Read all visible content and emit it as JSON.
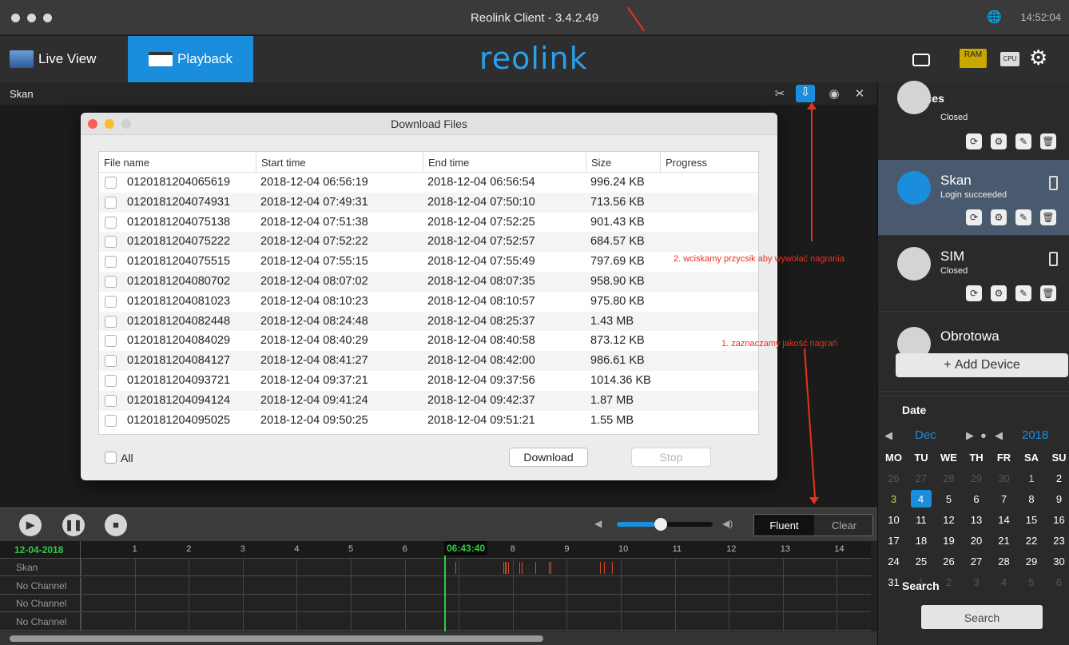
{
  "window": {
    "title": "Reolink Client - 3.4.2.49",
    "clock": "14:52:04"
  },
  "nav": {
    "live_view": "Live View",
    "playback": "Playback",
    "logo": "reolink",
    "ram": "RAM",
    "cpu": "CPU"
  },
  "subbar": {
    "title": "Skan"
  },
  "dialog": {
    "title": "Download Files",
    "columns": [
      "File name",
      "Start time",
      "End time",
      "Size",
      "Progress"
    ],
    "rows": [
      {
        "name": "0120181204065619",
        "start": "2018-12-04 06:56:19",
        "end": "2018-12-04 06:56:54",
        "size": "996.24 KB"
      },
      {
        "name": "0120181204074931",
        "start": "2018-12-04 07:49:31",
        "end": "2018-12-04 07:50:10",
        "size": "713.56 KB"
      },
      {
        "name": "0120181204075138",
        "start": "2018-12-04 07:51:38",
        "end": "2018-12-04 07:52:25",
        "size": "901.43 KB"
      },
      {
        "name": "0120181204075222",
        "start": "2018-12-04 07:52:22",
        "end": "2018-12-04 07:52:57",
        "size": "684.57 KB"
      },
      {
        "name": "0120181204075515",
        "start": "2018-12-04 07:55:15",
        "end": "2018-12-04 07:55:49",
        "size": "797.69 KB"
      },
      {
        "name": "0120181204080702",
        "start": "2018-12-04 08:07:02",
        "end": "2018-12-04 08:07:35",
        "size": "958.90 KB"
      },
      {
        "name": "0120181204081023",
        "start": "2018-12-04 08:10:23",
        "end": "2018-12-04 08:10:57",
        "size": "975.80 KB"
      },
      {
        "name": "0120181204082448",
        "start": "2018-12-04 08:24:48",
        "end": "2018-12-04 08:25:37",
        "size": "1.43 MB"
      },
      {
        "name": "0120181204084029",
        "start": "2018-12-04 08:40:29",
        "end": "2018-12-04 08:40:58",
        "size": "873.12 KB"
      },
      {
        "name": "0120181204084127",
        "start": "2018-12-04 08:41:27",
        "end": "2018-12-04 08:42:00",
        "size": "986.61 KB"
      },
      {
        "name": "0120181204093721",
        "start": "2018-12-04 09:37:21",
        "end": "2018-12-04 09:37:56",
        "size": "1014.36 KB"
      },
      {
        "name": "0120181204094124",
        "start": "2018-12-04 09:41:24",
        "end": "2018-12-04 09:42:37",
        "size": "1.87 MB"
      },
      {
        "name": "0120181204095025",
        "start": "2018-12-04 09:50:25",
        "end": "2018-12-04 09:51:21",
        "size": "1.55 MB"
      }
    ],
    "all_label": "All",
    "download_label": "Download",
    "stop_label": "Stop"
  },
  "controls": {
    "fluent": "Fluent",
    "clear": "Clear",
    "volume_level": 0.4
  },
  "timeline": {
    "date": "12-04-2018",
    "current_time": "06:43:40",
    "hours": [
      "1",
      "2",
      "3",
      "4",
      "5",
      "6",
      "7",
      "8",
      "9",
      "10",
      "11",
      "12",
      "13",
      "14"
    ],
    "channels": [
      "Skan",
      "No Channel",
      "No Channel",
      "No Channel"
    ]
  },
  "devices": {
    "header": "Devices",
    "list": [
      {
        "name": "",
        "status": "Closed"
      },
      {
        "name": "Skan",
        "status": "Login succeeded"
      },
      {
        "name": "SIM",
        "status": "Closed"
      },
      {
        "name": "Obrotowa",
        "status": ""
      }
    ],
    "add_label": "Add Device"
  },
  "calendar": {
    "header": "Date",
    "month": "Dec",
    "year": "2018",
    "weekdays": [
      "MO",
      "TU",
      "WE",
      "TH",
      "FR",
      "SA",
      "SU"
    ],
    "weeks": [
      [
        "26",
        "27",
        "28",
        "29",
        "30",
        "1",
        "2"
      ],
      [
        "3",
        "4",
        "5",
        "6",
        "7",
        "8",
        "9"
      ],
      [
        "10",
        "11",
        "12",
        "13",
        "14",
        "15",
        "16"
      ],
      [
        "17",
        "18",
        "19",
        "20",
        "21",
        "22",
        "23"
      ],
      [
        "24",
        "25",
        "26",
        "27",
        "28",
        "29",
        "30"
      ],
      [
        "31",
        "1",
        "2",
        "3",
        "4",
        "5",
        "6"
      ]
    ],
    "selected": "4"
  },
  "search": {
    "header": "Search",
    "button": "Search"
  },
  "annotations": {
    "step2": "2. wciskamy przycsik aby wywołać nagrania",
    "step1": "1. zaznaczamy jakość nagrań"
  },
  "colors": {
    "accent": "#1a8ddc",
    "annotation": "#e8321c",
    "timeline_now": "#2ecc40"
  }
}
